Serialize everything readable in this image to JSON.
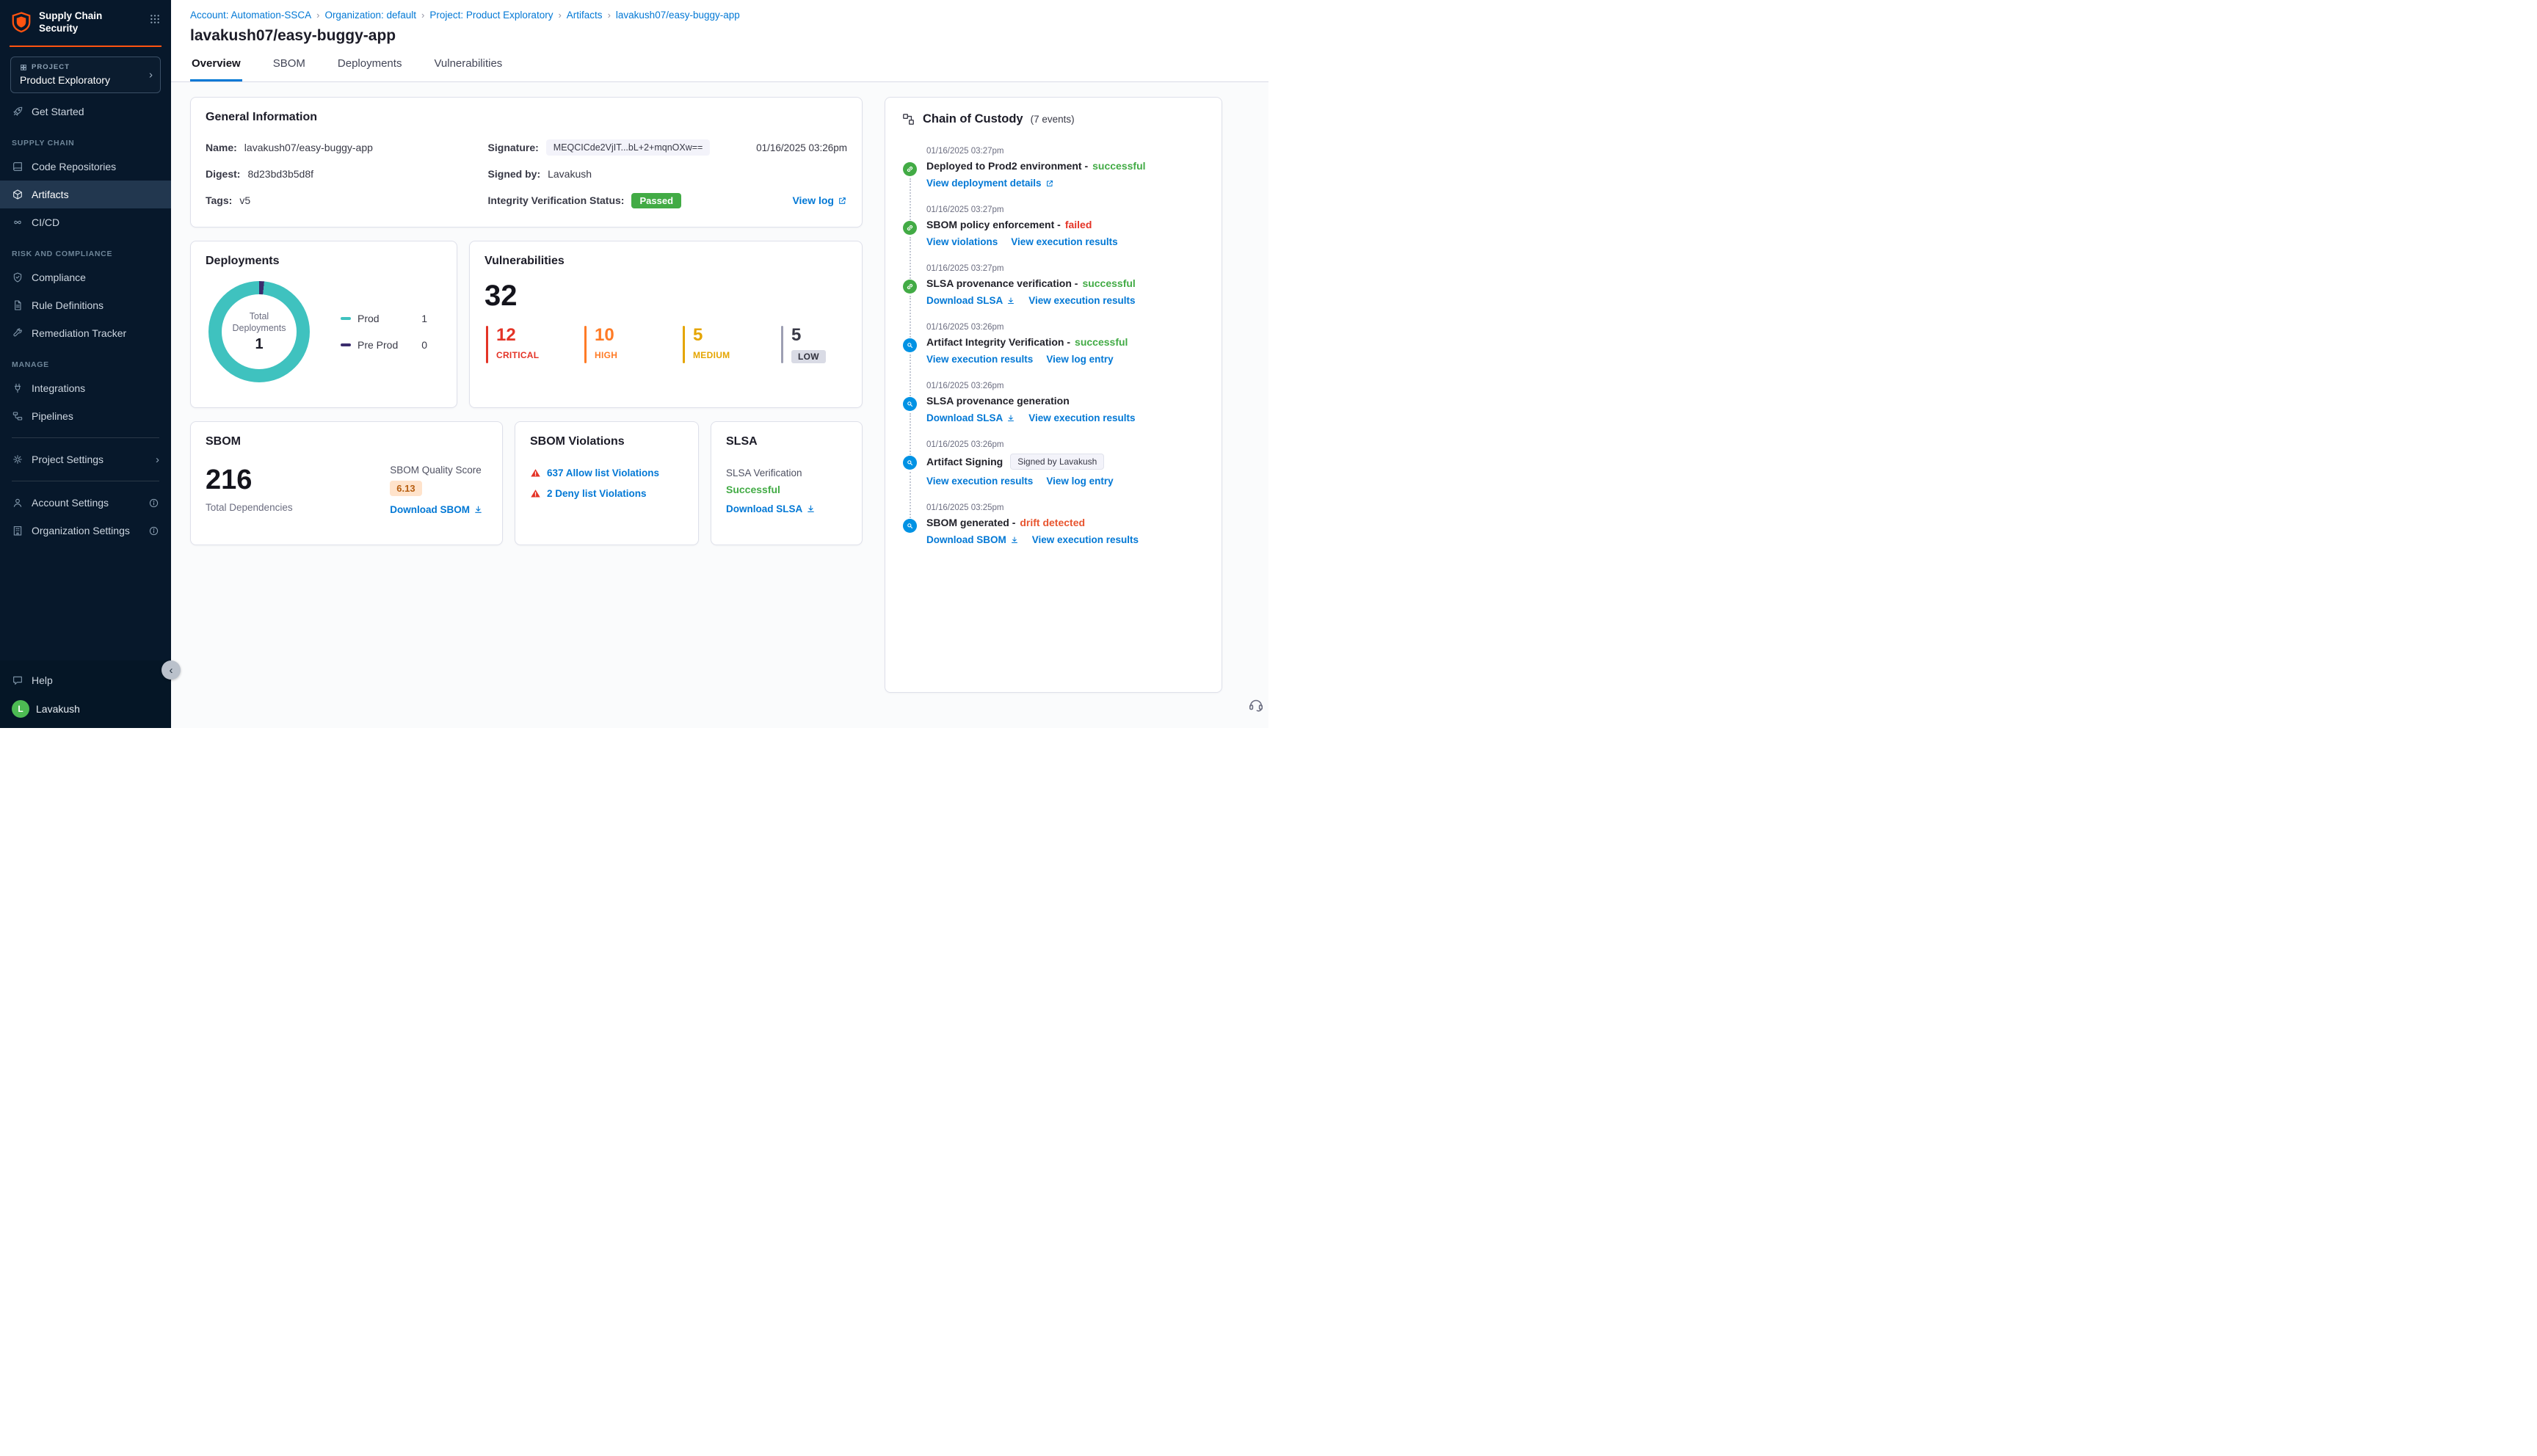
{
  "app": {
    "title": "Supply Chain Security"
  },
  "sidebar": {
    "project": {
      "label": "PROJECT",
      "name": "Product Exploratory"
    },
    "get_started": "Get Started",
    "section_supply_chain": "SUPPLY CHAIN",
    "code_repositories": "Code Repositories",
    "artifacts": "Artifacts",
    "cicd": "CI/CD",
    "section_risk": "RISK AND COMPLIANCE",
    "compliance": "Compliance",
    "rule_definitions": "Rule Definitions",
    "remediation_tracker": "Remediation Tracker",
    "section_manage": "MANAGE",
    "integrations": "Integrations",
    "pipelines": "Pipelines",
    "project_settings": "Project Settings",
    "account_settings": "Account Settings",
    "organization_settings": "Organization Settings",
    "help": "Help",
    "user": {
      "initial": "L",
      "name": "Lavakush"
    }
  },
  "breadcrumb": {
    "items": [
      "Account: Automation-SSCA",
      "Organization: default",
      "Project: Product Exploratory",
      "Artifacts",
      "lavakush07/easy-buggy-app"
    ]
  },
  "header": {
    "title": "lavakush07/easy-buggy-app",
    "tabs": [
      "Overview",
      "SBOM",
      "Deployments",
      "Vulnerabilities"
    ]
  },
  "general_info": {
    "title": "General Information",
    "name_label": "Name:",
    "name": "lavakush07/easy-buggy-app",
    "digest_label": "Digest:",
    "digest": "8d23bd3b5d8f",
    "tags_label": "Tags:",
    "tags": "v5",
    "signature_label": "Signature:",
    "signature": "MEQCICde2VjIT...bL+2+mqnOXw==",
    "signature_time": "01/16/2025 03:26pm",
    "signed_by_label": "Signed by:",
    "signed_by": "Lavakush",
    "integrity_label": "Integrity Verification Status:",
    "integrity_status": "Passed",
    "view_log": "View log"
  },
  "deployments_card": {
    "title": "Deployments",
    "center_label": "Total Deployments",
    "total": "1",
    "legend": [
      {
        "label": "Prod",
        "value": "1",
        "color": "#3fc2bf"
      },
      {
        "label": "Pre Prod",
        "value": "0",
        "color": "#3a2c6d"
      }
    ]
  },
  "vulnerabilities_card": {
    "title": "Vulnerabilities",
    "total": "32",
    "severities": [
      {
        "label": "CRITICAL",
        "count": "12",
        "color": "#e43326"
      },
      {
        "label": "HIGH",
        "count": "10",
        "color": "#ff7b26"
      },
      {
        "label": "MEDIUM",
        "count": "5",
        "color": "#e5a500"
      },
      {
        "label": "LOW",
        "count": "5",
        "color": "#9d9fb3"
      }
    ]
  },
  "sbom_card": {
    "title": "SBOM",
    "total": "216",
    "total_label": "Total Dependencies",
    "score_label": "SBOM Quality Score",
    "score": "6.13",
    "download": "Download SBOM"
  },
  "sbom_violations_card": {
    "title": "SBOM Violations",
    "items": [
      {
        "label": "637 Allow list Violations"
      },
      {
        "label": "2 Deny list Violations"
      }
    ]
  },
  "slsa_card": {
    "title": "SLSA",
    "verification_label": "SLSA Verification",
    "status": "Successful",
    "download": "Download SLSA"
  },
  "chain_of_custody": {
    "title": "Chain of Custody",
    "events_count": "(7 events)",
    "events": [
      {
        "time": "01/16/2025 03:27pm",
        "title": "Deployed to Prod2 environment -",
        "status": "successful",
        "links": [
          {
            "label": "View deployment details",
            "icon": "external"
          }
        ]
      },
      {
        "time": "01/16/2025 03:27pm",
        "title": "SBOM policy enforcement -",
        "status": "failed",
        "links": [
          {
            "label": "View violations"
          },
          {
            "label": "View execution results"
          }
        ]
      },
      {
        "time": "01/16/2025 03:27pm",
        "title": "SLSA provenance verification -",
        "status": "successful",
        "links": [
          {
            "label": "Download SLSA",
            "icon": "download"
          },
          {
            "label": "View execution results"
          }
        ]
      },
      {
        "time": "01/16/2025 03:26pm",
        "title": "Artifact Integrity Verification -",
        "status": "successful",
        "links": [
          {
            "label": "View execution results"
          },
          {
            "label": "View log entry"
          }
        ]
      },
      {
        "time": "01/16/2025 03:26pm",
        "title": "SLSA provenance generation",
        "status": "",
        "links": [
          {
            "label": "Download SLSA",
            "icon": "download"
          },
          {
            "label": "View execution results"
          }
        ]
      },
      {
        "time": "01/16/2025 03:26pm",
        "title": "Artifact Signing",
        "status": "",
        "badge": "Signed by Lavakush",
        "links": [
          {
            "label": "View execution results"
          },
          {
            "label": "View log entry"
          }
        ]
      },
      {
        "time": "01/16/2025 03:25pm",
        "title": "SBOM generated -",
        "status": "drift detected",
        "links": [
          {
            "label": "Download SBOM",
            "icon": "download"
          },
          {
            "label": "View execution results"
          }
        ]
      }
    ]
  },
  "colors": {
    "accent_orange": "#ff5310",
    "link_blue": "#0278d5",
    "success_green": "#42ab45",
    "failed_red": "#e43326",
    "drift_orange": "#e8552f",
    "donut_teal": "#3fc2bf",
    "preprod_purple": "#3a2c6d",
    "sidebar_navy": "#07182b"
  }
}
